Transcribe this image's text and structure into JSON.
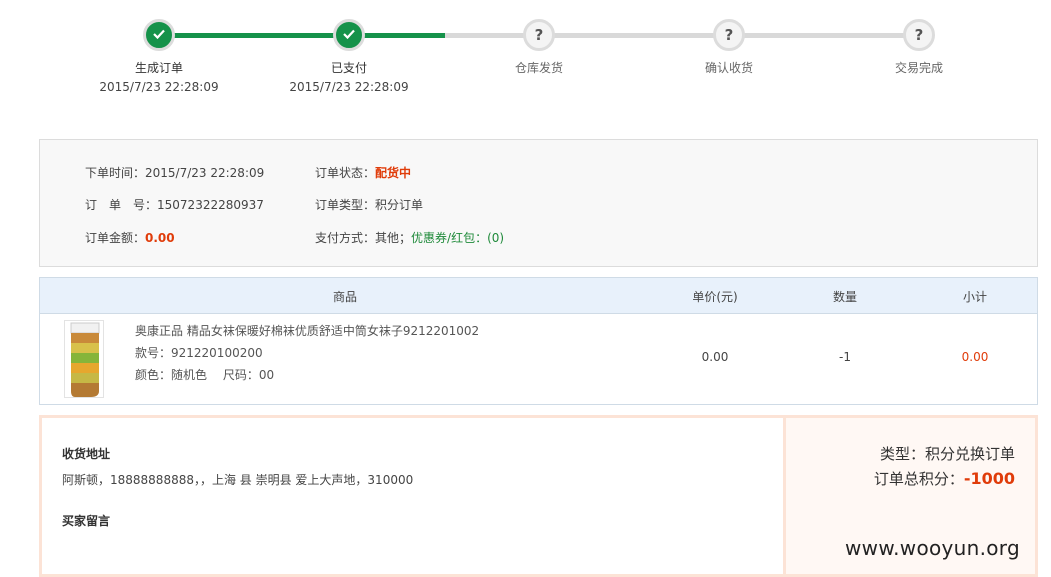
{
  "progress": {
    "steps": [
      {
        "label": "生成订单",
        "time": "2015/7/23 22:28:09",
        "status": "done"
      },
      {
        "label": "已支付",
        "time": "2015/7/23 22:28:09",
        "status": "done"
      },
      {
        "label": "仓库发货",
        "time": "",
        "status": "todo"
      },
      {
        "label": "确认收货",
        "time": "",
        "status": "todo"
      },
      {
        "label": "交易完成",
        "time": "",
        "status": "todo"
      }
    ],
    "done_icon": "check-icon",
    "todo_icon": "question-icon",
    "todo_symbol": "?"
  },
  "order_info": {
    "order_time_label": "下单时间：",
    "order_time": "2015/7/23 22:28:09",
    "order_no_label": "订　单　号：",
    "order_no": "15072322280937",
    "amount_label": "订单金额：",
    "amount": "0.00",
    "status_label": "订单状态：",
    "status": "配货中",
    "type_label": "订单类型：",
    "type": "积分订单",
    "pay_label": "支付方式：",
    "pay_method": "其他；",
    "coupon": "优惠券/红包：(0)"
  },
  "goods_table": {
    "headers": [
      "商品",
      "单价(元)",
      "数量",
      "小计"
    ],
    "rows": [
      {
        "name": "奥康正品 精品女袜保暖好棉袜优质舒适中筒女袜子9212201002",
        "sku": "款号：921220100200",
        "attrs": "颜色：随机色　 尺码：00",
        "unit_price": "0.00",
        "qty": "-1",
        "subtotal": "0.00"
      }
    ]
  },
  "shipping": {
    "address_title": "收货地址",
    "address": "阿斯顿，18888888888，，上海 县 崇明县 爱上大声地，310000",
    "message_title": "买家留言",
    "message": ""
  },
  "summary": {
    "type_line": "类型：积分兑换订单",
    "points_label": "订单总积分：",
    "points": "-1000"
  },
  "watermark": "www.wooyun.org",
  "colors": {
    "accent_green": "#15924a",
    "price_red": "#e03c0a"
  }
}
